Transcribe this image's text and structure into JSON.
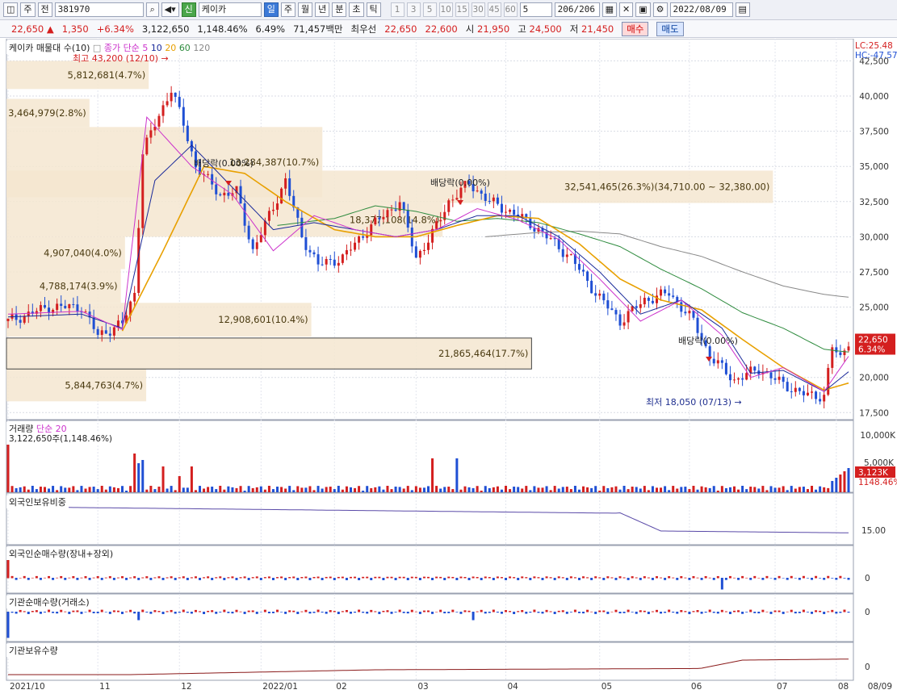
{
  "toolbar": {
    "mode": "주",
    "prev_label": "전",
    "code": "381970",
    "name": "케이카",
    "new_badge": "신",
    "periods": [
      "일",
      "주",
      "월",
      "년",
      "분",
      "초",
      "틱"
    ],
    "active_period": "일",
    "numbers": [
      "1",
      "3",
      "5",
      "10",
      "15",
      "30",
      "45",
      "60"
    ],
    "count_select": "5",
    "page_counter": "206/206",
    "date": "2022/08/09"
  },
  "quote": {
    "price": "22,650",
    "arrow": "▲",
    "change": "1,350",
    "change_pct": "+6.34%",
    "volume": "3,122,650",
    "volume_ratio": "1,148.46%",
    "turnover": "6.49%",
    "amount": "71,457백만",
    "priority_label": "최우선",
    "ask": "22,650",
    "bid": "22,600",
    "open_label": "시",
    "open": "21,950",
    "high_label": "고",
    "high": "24,500",
    "low_label": "저",
    "low": "21,450",
    "buy_label": "매수",
    "sell_label": "매도"
  },
  "legends": {
    "price_title": "케이카 매물대 수(10)",
    "ma_prefix": "종가 단순",
    "ma_periods": [
      "5",
      "10",
      "20",
      "60",
      "120"
    ],
    "volume_title": "거래량",
    "volume_prefix": "단순",
    "volume_value": "3,122,650주(1,148.46%)",
    "foreign_ratio": "외국인보유비중",
    "foreign_net": "외국인순매수량(장내+장외)",
    "inst_net": "기관순매수량(거래소)",
    "inst_hold": "기관보유수량"
  },
  "annotations": {
    "high": "최고 43,200 (12/10)",
    "low": "최저 18,050 (07/13)",
    "dividend1": "배당락(0.00%)",
    "dividend2": "배당락(0.00%)",
    "dividend3": "배당락(0.00%)"
  },
  "right_badges": {
    "lc": "LC:25.48",
    "hc": "HC:-47.57",
    "price": "22,650",
    "pct": "6.34%",
    "vol": "3,123K",
    "vol_pct": "1148.46%"
  },
  "colors": {
    "up": "#d41f1f",
    "down": "#1f4fd4",
    "ma5": "#cc33cc",
    "ma10": "#1a2a9a",
    "ma20": "#e8a000",
    "ma60": "#2e8b3e",
    "ma120": "#888888",
    "profile": "#f5e6d0"
  },
  "chart_data": {
    "type": "candlestick",
    "y_ticks": [
      "42,500",
      "40,000",
      "37,500",
      "35,000",
      "32,500",
      "30,000",
      "27,500",
      "25,000",
      "20,000",
      "17,500"
    ],
    "y_range": [
      17000,
      43500
    ],
    "x_labels": [
      "2021/10",
      "11",
      "12",
      "2022/01",
      "02",
      "03",
      "04",
      "05",
      "06",
      "07",
      "08",
      "08/09"
    ],
    "volume_ticks": [
      "10,000K",
      "5,000K"
    ],
    "foreign_ratio_ticks": [
      "15.00"
    ],
    "zero_label": "0",
    "volume_profile": [
      {
        "label": "5,812,681(4.7%)",
        "price_low": 40500,
        "price_high": 42500,
        "length": 0.168
      },
      {
        "label": "3,464,979(2.8%)",
        "price_low": 37800,
        "price_high": 39800,
        "length": 0.098
      },
      {
        "label": "13,284,387(10.7%)",
        "price_low": 32800,
        "price_high": 37800,
        "length": 0.373
      },
      {
        "label": "32,541,465(26.3%)(34,710.00 ~ 32,380.00)",
        "price_low": 32400,
        "price_high": 34700,
        "length": 0.905
      },
      {
        "label": "18,377,108(14.8%)",
        "price_low": 30000,
        "price_high": 32400,
        "length": 0.515
      },
      {
        "label": "4,907,040(4.0%)",
        "price_low": 27700,
        "price_high": 30000,
        "length": 0.14
      },
      {
        "label": "4,788,174(3.9%)",
        "price_low": 25300,
        "price_high": 27700,
        "length": 0.135
      },
      {
        "label": "12,908,601(10.4%)",
        "price_low": 22900,
        "price_high": 25300,
        "length": 0.36
      },
      {
        "label": "21,865,464(17.7%)",
        "price_low": 20600,
        "price_high": 22800,
        "length": 0.62
      },
      {
        "label": "5,844,763(4.7%)",
        "price_low": 18300,
        "price_high": 20600,
        "length": 0.165
      }
    ],
    "ma_anchors": {
      "ma5": [
        [
          0,
          24500
        ],
        [
          18,
          24700
        ],
        [
          28,
          23400
        ],
        [
          34,
          38500
        ],
        [
          45,
          35000
        ],
        [
          55,
          33000
        ],
        [
          65,
          29000
        ],
        [
          75,
          31500
        ],
        [
          85,
          30500
        ],
        [
          95,
          30000
        ],
        [
          105,
          30500
        ],
        [
          115,
          32000
        ],
        [
          125,
          31200
        ],
        [
          135,
          29800
        ],
        [
          145,
          27000
        ],
        [
          155,
          24000
        ],
        [
          165,
          25500
        ],
        [
          175,
          23000
        ],
        [
          182,
          20000
        ],
        [
          190,
          20700
        ],
        [
          200,
          19000
        ],
        [
          206,
          21500
        ]
      ],
      "ma10": [
        [
          0,
          24300
        ],
        [
          18,
          24500
        ],
        [
          28,
          23500
        ],
        [
          36,
          34000
        ],
        [
          45,
          36500
        ],
        [
          55,
          33500
        ],
        [
          65,
          30500
        ],
        [
          75,
          31000
        ],
        [
          85,
          30500
        ],
        [
          95,
          30000
        ],
        [
          105,
          30500
        ],
        [
          115,
          31500
        ],
        [
          125,
          31500
        ],
        [
          135,
          30000
        ],
        [
          145,
          27500
        ],
        [
          155,
          24500
        ],
        [
          165,
          25500
        ],
        [
          175,
          23500
        ],
        [
          182,
          20300
        ],
        [
          190,
          20500
        ],
        [
          200,
          19000
        ],
        [
          206,
          20400
        ]
      ],
      "ma20": [
        [
          28,
          23300
        ],
        [
          38,
          29000
        ],
        [
          48,
          35000
        ],
        [
          58,
          34500
        ],
        [
          68,
          32500
        ],
        [
          80,
          30500
        ],
        [
          90,
          30000
        ],
        [
          100,
          30000
        ],
        [
          110,
          30800
        ],
        [
          120,
          31500
        ],
        [
          130,
          31300
        ],
        [
          140,
          29500
        ],
        [
          150,
          27000
        ],
        [
          160,
          25500
        ],
        [
          170,
          24800
        ],
        [
          180,
          22700
        ],
        [
          190,
          20700
        ],
        [
          200,
          19100
        ],
        [
          206,
          19600
        ]
      ],
      "ma60": [
        [
          66,
          30800
        ],
        [
          80,
          31300
        ],
        [
          90,
          32200
        ],
        [
          100,
          31800
        ],
        [
          110,
          31100
        ],
        [
          120,
          31300
        ],
        [
          130,
          31000
        ],
        [
          140,
          30200
        ],
        [
          150,
          29300
        ],
        [
          160,
          27700
        ],
        [
          170,
          26300
        ],
        [
          180,
          24600
        ],
        [
          190,
          23500
        ],
        [
          200,
          22000
        ],
        [
          206,
          21800
        ]
      ],
      "ma120": [
        [
          117,
          30000
        ],
        [
          130,
          30300
        ],
        [
          140,
          30400
        ],
        [
          150,
          30200
        ],
        [
          160,
          29300
        ],
        [
          170,
          28600
        ],
        [
          180,
          27500
        ],
        [
          190,
          26500
        ],
        [
          200,
          25900
        ],
        [
          206,
          25700
        ]
      ]
    },
    "candle_anchors": [
      [
        0,
        24000
      ],
      [
        10,
        25000
      ],
      [
        18,
        25000
      ],
      [
        22,
        23000
      ],
      [
        28,
        23800
      ],
      [
        31,
        26000
      ],
      [
        33,
        36000
      ],
      [
        36,
        38000
      ],
      [
        40,
        40500
      ],
      [
        43,
        38000
      ],
      [
        46,
        35000
      ],
      [
        52,
        33000
      ],
      [
        56,
        33200
      ],
      [
        60,
        29000
      ],
      [
        64,
        31500
      ],
      [
        68,
        34000
      ],
      [
        72,
        30000
      ],
      [
        76,
        28000
      ],
      [
        82,
        28500
      ],
      [
        88,
        30500
      ],
      [
        92,
        31500
      ],
      [
        96,
        32500
      ],
      [
        100,
        28500
      ],
      [
        104,
        30200
      ],
      [
        108,
        32500
      ],
      [
        113,
        33800
      ],
      [
        118,
        32500
      ],
      [
        125,
        31500
      ],
      [
        130,
        30500
      ],
      [
        138,
        28500
      ],
      [
        144,
        26000
      ],
      [
        150,
        24000
      ],
      [
        156,
        25500
      ],
      [
        162,
        26000
      ],
      [
        168,
        24000
      ],
      [
        172,
        21500
      ],
      [
        178,
        19800
      ],
      [
        184,
        20600
      ],
      [
        190,
        19500
      ],
      [
        196,
        18700
      ],
      [
        200,
        18700
      ],
      [
        202,
        22200
      ],
      [
        204,
        21300
      ],
      [
        206,
        22650
      ]
    ],
    "bars_count": 207
  }
}
